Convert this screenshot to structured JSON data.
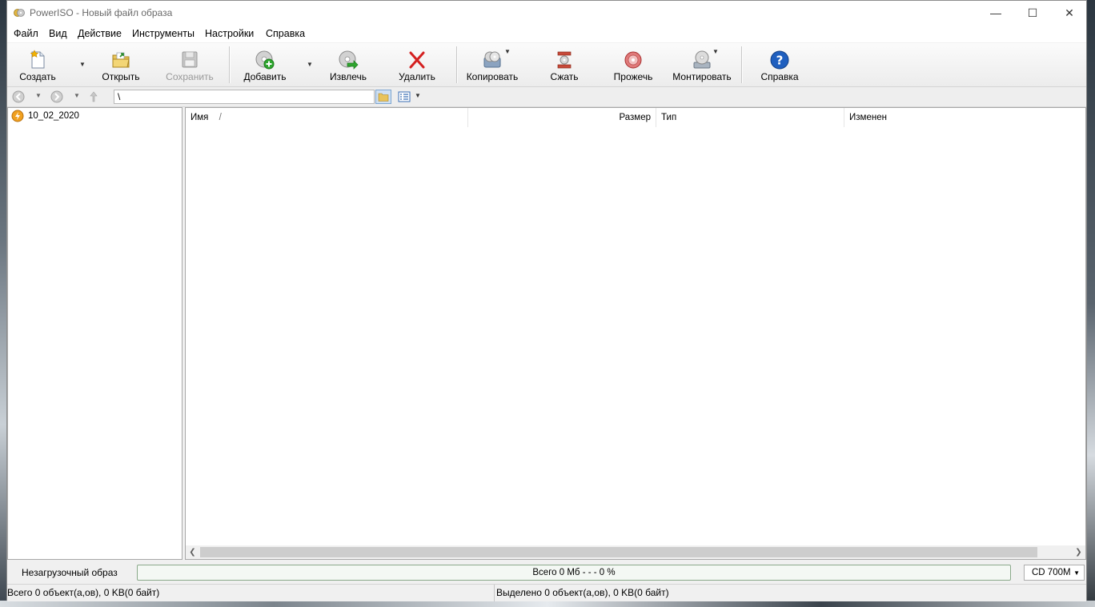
{
  "window": {
    "title": "PowerISO - Новый файл образа",
    "minimize_glyph": "—",
    "maximize_glyph": "☐",
    "close_glyph": "✕"
  },
  "menu": [
    "Файл",
    "Вид",
    "Действие",
    "Инструменты",
    "Настройки",
    "Справка"
  ],
  "toolbar": {
    "create": "Создать",
    "open": "Открыть",
    "save": "Сохранить",
    "add": "Добавить",
    "extract": "Извлечь",
    "delete": "Удалить",
    "copy": "Копировать",
    "compress": "Сжать",
    "burn": "Прожечь",
    "mount": "Монтировать",
    "help": "Справка"
  },
  "navigation": {
    "path": "\\"
  },
  "tree": {
    "root_label": "10_02_2020"
  },
  "file_list": {
    "columns": {
      "name": "Имя",
      "sort_indicator": "/",
      "size": "Размер",
      "type": "Тип",
      "modified": "Изменен"
    },
    "rows": []
  },
  "status": {
    "boot_type": "Незагрузочный образ",
    "total_size": "Всего  0 Мб   - - -  0 %",
    "capacity": "CD 700M",
    "total_objects": "Всего 0 объект(а,ов), 0 KB(0 байт)",
    "selected_objects": "Выделено 0 объект(а,ов), 0 KB(0 байт)"
  },
  "icons": {
    "app": "poweriso-disc-icon",
    "create": "new-file-star-icon",
    "open": "open-folder-icon",
    "save": "floppy-disk-icon",
    "add": "disc-add-icon",
    "extract": "disc-extract-icon",
    "delete": "red-x-icon",
    "copy": "disc-copy-icon",
    "compress": "compress-icon",
    "burn": "burn-disc-icon",
    "mount": "mount-drive-icon",
    "help": "help-question-icon"
  },
  "colors": {
    "help_blue": "#1f5fbf",
    "delete_red": "#d42020",
    "add_green": "#2ea62e"
  }
}
